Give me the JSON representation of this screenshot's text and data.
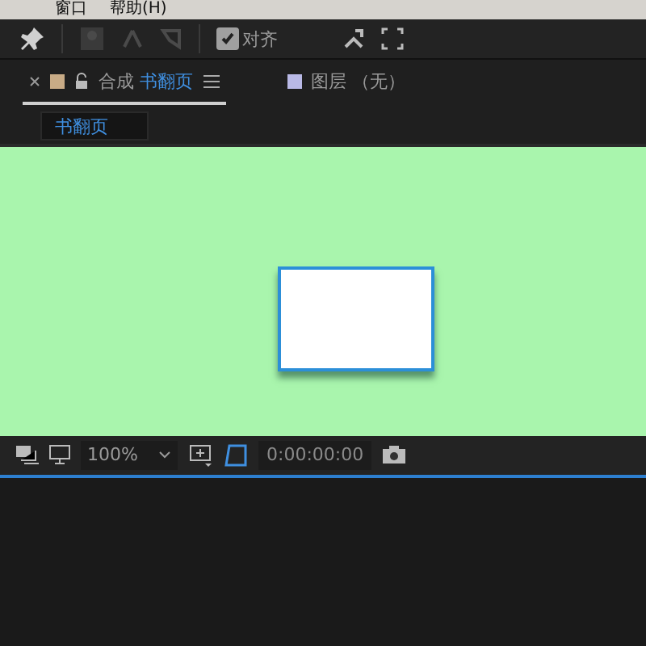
{
  "menu_bar": {
    "items": [
      "窗口",
      "帮助(H)"
    ]
  },
  "toolbar": {
    "align_checkbox": {
      "label": "对齐",
      "checked": true
    }
  },
  "composition_panel": {
    "tabs": [
      {
        "kind": "composition",
        "prefix": "合成",
        "label": "书翻页",
        "selected": true,
        "color": "#c8ab86"
      },
      {
        "kind": "layer",
        "prefix": "图层",
        "label": "（无）",
        "selected": false,
        "color": "#b9b9e6"
      }
    ],
    "breadcrumb": "书翻页"
  },
  "viewer": {
    "zoom": "100%",
    "timecode": "0:00:00:00"
  }
}
